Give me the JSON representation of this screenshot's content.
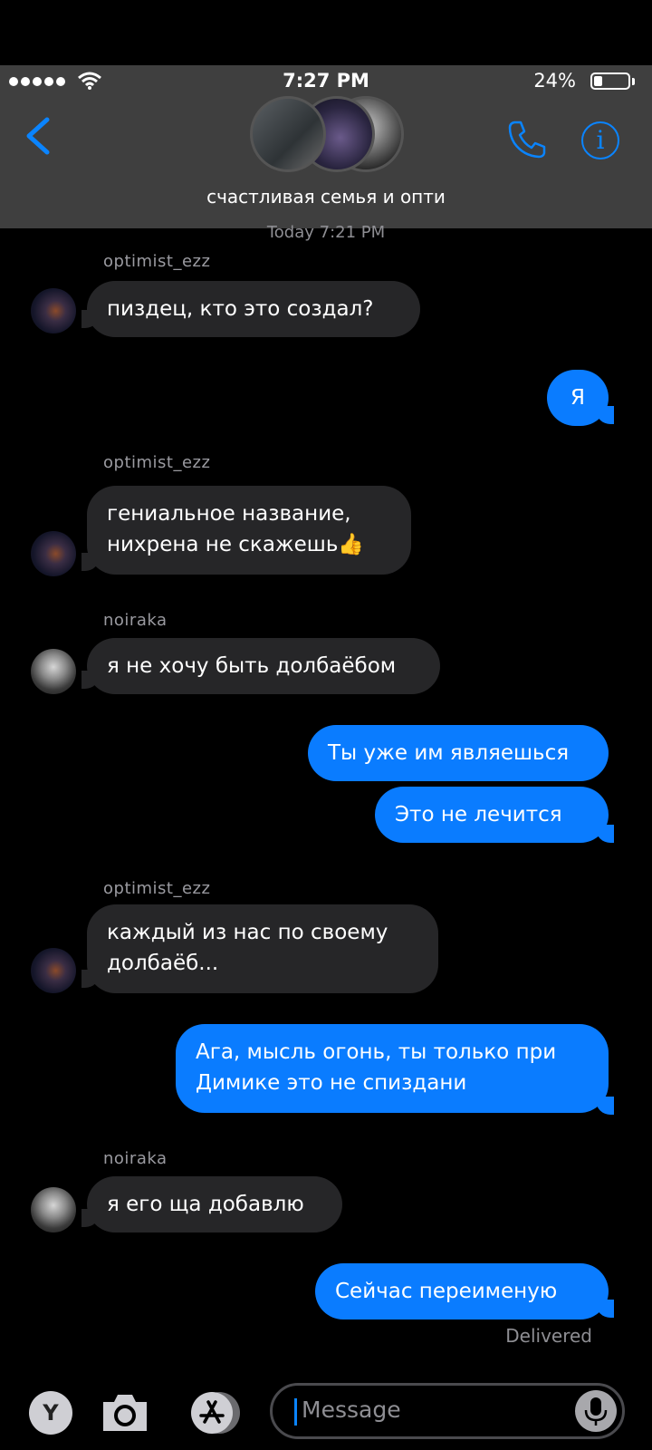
{
  "status": {
    "time": "7:27 PM",
    "battery": "24%",
    "battery_level": 0.24
  },
  "header": {
    "title": "счастливая семья и опти"
  },
  "timestamp": "Today 7:21 PM",
  "messages": [
    {
      "sender": "optimist_ezz",
      "text": "пиздец, кто это создал?"
    },
    {
      "text": "Я"
    },
    {
      "sender": "optimist_ezz",
      "line1": "гениальное название,",
      "line2": "нихрена не скажешь👍"
    },
    {
      "sender": "noiraka",
      "text": "я не хочу быть долбаёбом"
    },
    {
      "text": "Ты уже им являешься"
    },
    {
      "text": "Это не лечится"
    },
    {
      "sender": "optimist_ezz",
      "line1": "каждый из нас по своему",
      "line2": "долбаёб..."
    },
    {
      "line1": "Ага, мысль огонь, ты только при",
      "line2": "Димике это не спиздани"
    },
    {
      "sender": "noiraka",
      "text": "я его ща добавлю"
    },
    {
      "text": "Сейчас переименую"
    }
  ],
  "delivered": "Delivered",
  "composer": {
    "apps_label": "Y",
    "placeholder": "Message"
  },
  "colors": {
    "outgoing": "#0a7cff",
    "incoming": "#262628",
    "accent": "#0a84ff",
    "header_bg": "#3f3f3f"
  }
}
